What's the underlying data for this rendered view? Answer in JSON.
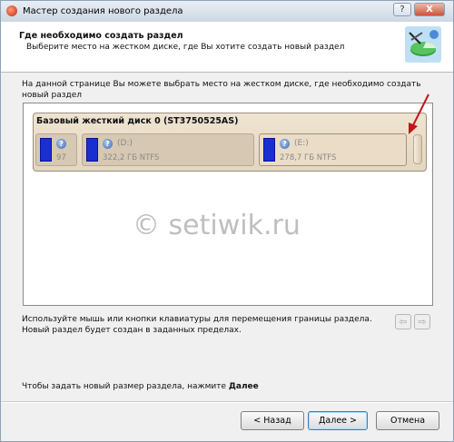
{
  "window": {
    "title": "Мастер создания нового раздела",
    "help_label": "?",
    "close_label": "X"
  },
  "header": {
    "title": "Где необходимо создать раздел",
    "subtitle": "Выберите место на жестком диске, где Вы хотите создать новый раздел"
  },
  "intro_text": "На данной странице Вы можете выбрать место на жестком диске, где необходимо создать новый раздел",
  "disk": {
    "label": "Базовый жесткий диск 0 (ST3750525AS)",
    "partitions": [
      {
        "name": "",
        "size": "97",
        "icon": "question-icon"
      },
      {
        "name": "(D:)",
        "size": "322,2 ГБ NTFS",
        "icon": "question-icon"
      },
      {
        "name": "(E:)",
        "size": "278,7 ГБ NTFS",
        "icon": "question-icon"
      }
    ]
  },
  "watermark": "© setiwik.ru",
  "hint_text": "Используйте мышь или кнопки клавиатуры для перемещения границы раздела. Новый раздел будет создан в заданных пределах.",
  "footer": {
    "hint_prefix": "Чтобы задать новый размер раздела, нажмите ",
    "hint_bold": "Далее"
  },
  "buttons": {
    "back": "< Назад",
    "next": "Далее >",
    "cancel": "Отмена"
  },
  "colors": {
    "partition_bar": "#1a2fd0",
    "annotation_arrow": "#c0161b"
  }
}
